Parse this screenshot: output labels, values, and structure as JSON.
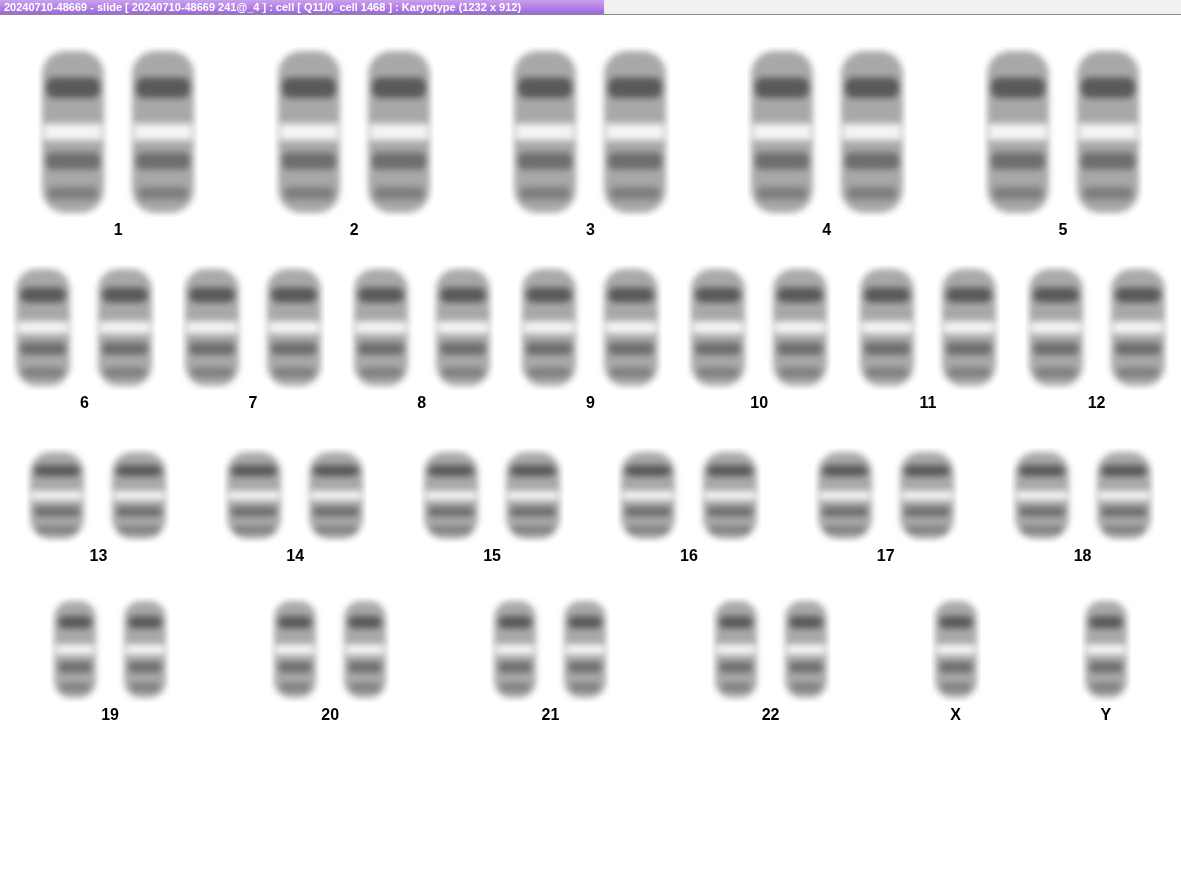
{
  "window": {
    "title": "20240710-48669 - slide [ 20240710-48669 241@_4 ] : cell [ Q11/0_cell 1468 ] : Karyotype  (1232 x 912)"
  },
  "karyotype": {
    "rows": [
      [
        {
          "label": "1",
          "kind": "pair"
        },
        {
          "label": "2",
          "kind": "pair"
        },
        {
          "label": "3",
          "kind": "pair"
        },
        {
          "label": "4",
          "kind": "pair"
        },
        {
          "label": "5",
          "kind": "pair"
        }
      ],
      [
        {
          "label": "6",
          "kind": "pair"
        },
        {
          "label": "7",
          "kind": "pair"
        },
        {
          "label": "8",
          "kind": "pair"
        },
        {
          "label": "9",
          "kind": "pair"
        },
        {
          "label": "10",
          "kind": "pair"
        },
        {
          "label": "11",
          "kind": "pair"
        },
        {
          "label": "12",
          "kind": "pair"
        }
      ],
      [
        {
          "label": "13",
          "kind": "pair"
        },
        {
          "label": "14",
          "kind": "pair"
        },
        {
          "label": "15",
          "kind": "pair"
        },
        {
          "label": "16",
          "kind": "pair"
        },
        {
          "label": "17",
          "kind": "pair"
        },
        {
          "label": "18",
          "kind": "pair"
        }
      ],
      [
        {
          "label": "19",
          "kind": "pair"
        },
        {
          "label": "20",
          "kind": "pair"
        },
        {
          "label": "21",
          "kind": "pair"
        },
        {
          "label": "22",
          "kind": "pair"
        },
        {
          "label": "X",
          "kind": "single"
        },
        {
          "label": "Y",
          "kind": "single"
        }
      ]
    ]
  }
}
